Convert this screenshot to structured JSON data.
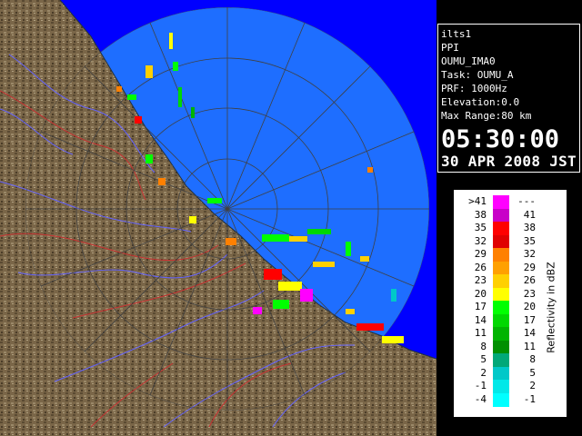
{
  "info": {
    "station": "ilts1",
    "scan_type": "PPI",
    "product": "OUMU_IMA0",
    "task": "Task: OUMU_A",
    "prf": "PRF: 1000Hz",
    "elevation": "Elevation:0.0",
    "max_range": "Max Range:80 km",
    "time": "05:30:00",
    "date": "30 APR 2008 JST"
  },
  "legend": {
    "title": "Reflectivity in dBZ",
    "bins": [
      {
        "low": ">41",
        "high": "---",
        "color": "#ff00ff"
      },
      {
        "low": "38",
        "high": "41",
        "color": "#c800c8"
      },
      {
        "low": "35",
        "high": "38",
        "color": "#ff0000"
      },
      {
        "low": "32",
        "high": "35",
        "color": "#e00000"
      },
      {
        "low": "29",
        "high": "32",
        "color": "#ff8000"
      },
      {
        "low": "26",
        "high": "29",
        "color": "#ffa000"
      },
      {
        "low": "23",
        "high": "26",
        "color": "#ffd000"
      },
      {
        "low": "20",
        "high": "23",
        "color": "#ffff00"
      },
      {
        "low": "17",
        "high": "20",
        "color": "#00ff00"
      },
      {
        "low": "14",
        "high": "17",
        "color": "#00d800"
      },
      {
        "low": "11",
        "high": "14",
        "color": "#00b400"
      },
      {
        "low": "8",
        "high": "11",
        "color": "#009000"
      },
      {
        "low": "5",
        "high": "8",
        "color": "#00a878"
      },
      {
        "low": "2",
        "high": "5",
        "color": "#00c8c8"
      },
      {
        "low": "-1",
        "high": "2",
        "color": "#00e8e8"
      },
      {
        "low": "-4",
        "high": "-1",
        "color": "#00ffff"
      }
    ]
  },
  "colors": {
    "sea_outer": "#0000ff",
    "sea_inner": "#1e6eff",
    "land": "#7d6b4d",
    "rivers": "#6464ff",
    "borders": "#c83232"
  }
}
